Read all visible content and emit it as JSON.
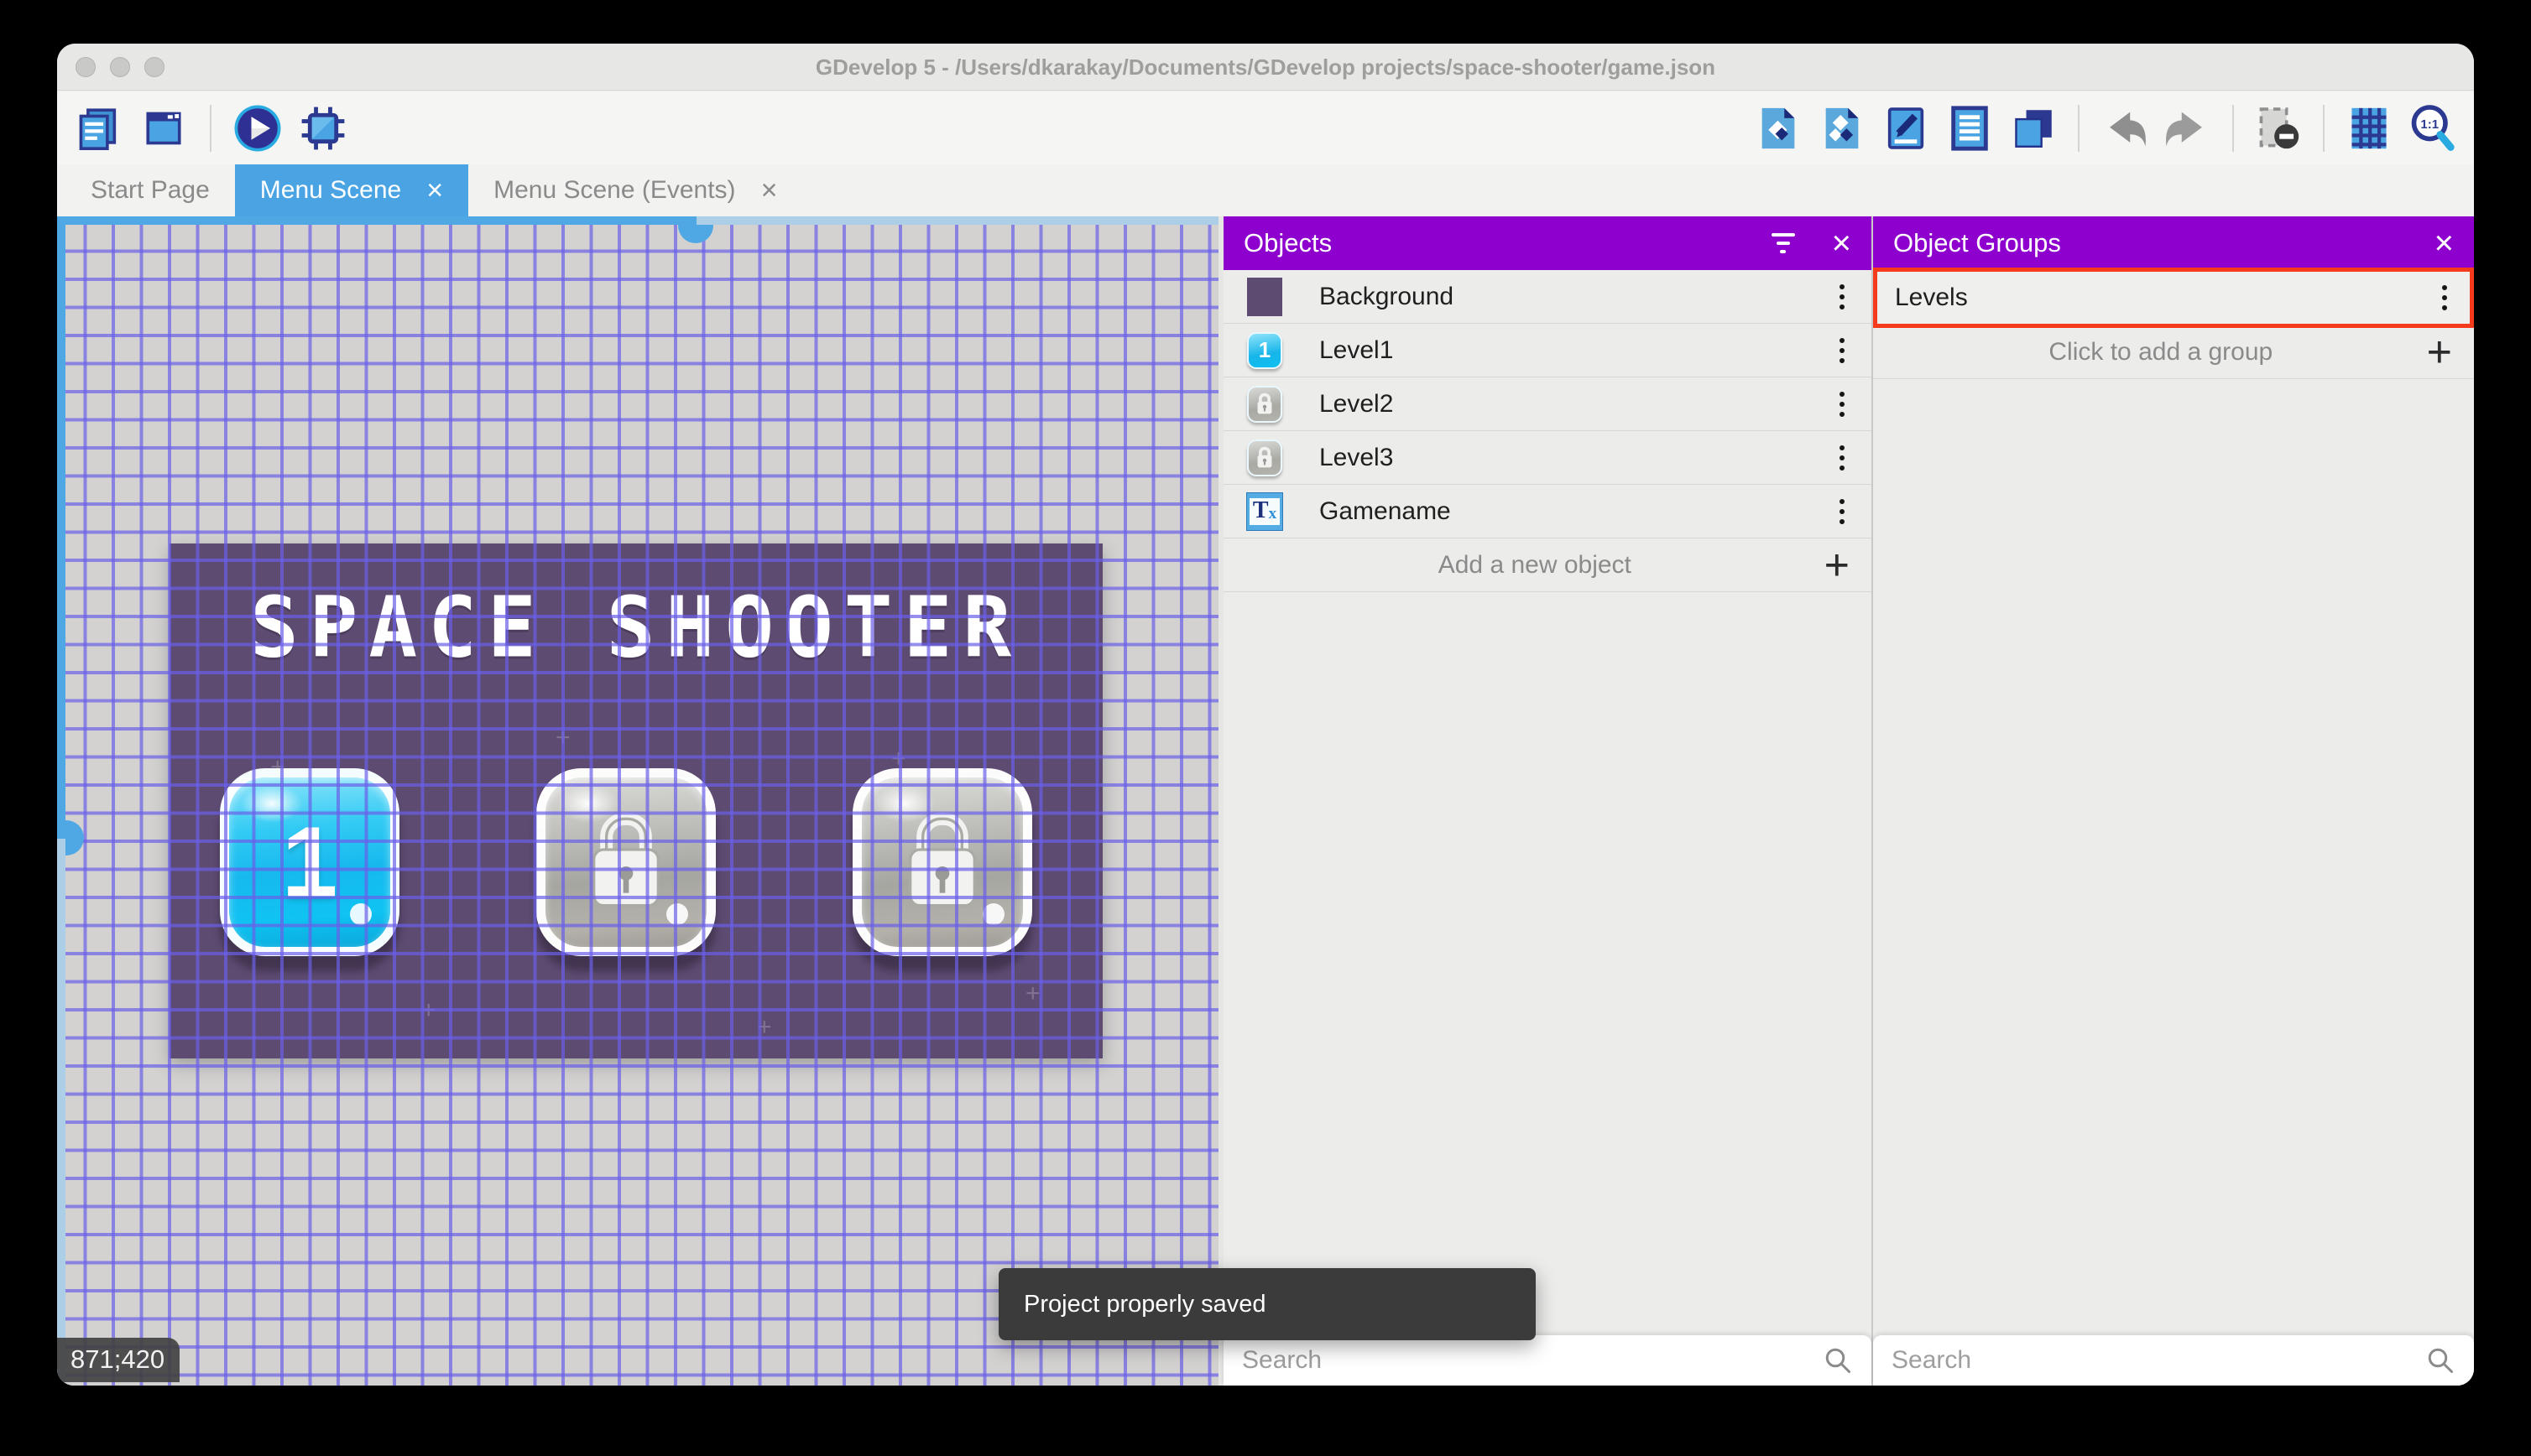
{
  "titlebar": {
    "title": "GDevelop 5 - /Users/dkarakay/Documents/GDevelop projects/space-shooter/game.json"
  },
  "tabs": {
    "start": "Start Page",
    "scene": "Menu Scene",
    "events": "Menu Scene (Events)"
  },
  "toolbar": {
    "left_icons": [
      "project-manager-icon",
      "scene-window-icon",
      "preview-play-icon",
      "debug-icon"
    ],
    "right_icons": [
      "objects-editor-icon",
      "object-groups-icon",
      "properties-icon",
      "instances-list-icon",
      "layers-icon",
      "undo-icon",
      "redo-icon",
      "window-mask-icon",
      "grid-icon",
      "zoom-original-icon"
    ]
  },
  "canvas": {
    "coordinates": "871;420",
    "scene": {
      "title": "SPACE SHOOTER",
      "buttons": [
        {
          "label": "1",
          "locked": false
        },
        {
          "locked": true
        },
        {
          "locked": true
        }
      ]
    }
  },
  "objects_panel": {
    "title": "Objects",
    "items": [
      {
        "name": "Background",
        "thumb": "purple-square"
      },
      {
        "name": "Level1",
        "thumb": "cyan-button-1"
      },
      {
        "name": "Level2",
        "thumb": "gray-lock-button"
      },
      {
        "name": "Level3",
        "thumb": "gray-lock-button"
      },
      {
        "name": "Gamename",
        "thumb": "text-object"
      }
    ],
    "add_label": "Add a new object",
    "search_placeholder": "Search"
  },
  "groups_panel": {
    "title": "Object Groups",
    "items": [
      {
        "name": "Levels",
        "highlighted": true
      }
    ],
    "add_label": "Click to add a group",
    "search_placeholder": "Search"
  },
  "toast": {
    "message": "Project properly saved"
  },
  "colors": {
    "accent_blue": "#4AA4E3",
    "panel_purple": "#8E00CE",
    "highlight_red": "#F53B1C",
    "grid_line": "#6A5FE8",
    "scene_purple": "#5E4B72",
    "toast_bg": "#3B3B3B"
  }
}
